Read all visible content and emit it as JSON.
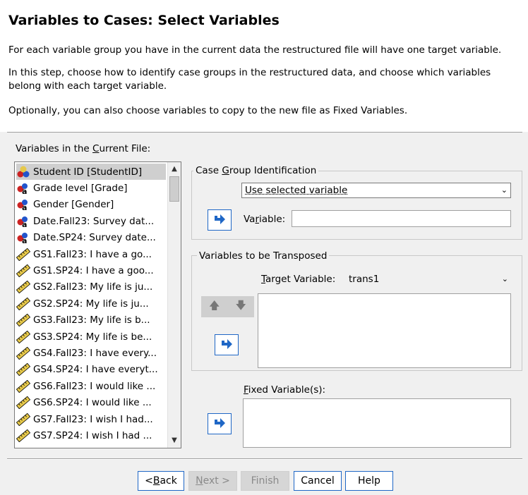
{
  "header": {
    "title": "Variables to Cases: Select Variables",
    "p1": "For each variable group you have in the current data the restructured file will have one target variable.",
    "p2": "In this step, choose how to identify case groups in the restructured data, and choose which variables belong with each target variable.",
    "p3": "Optionally, you can also choose variables to copy to the new file as Fixed Variables."
  },
  "source": {
    "label_pre": "Variables in the ",
    "label_u": "C",
    "label_post": "urrent File:",
    "items": [
      {
        "label": "Student ID [StudentID]",
        "icon": "nominal-icon",
        "selected": true
      },
      {
        "label": "Grade level [Grade]",
        "icon": "ordinal-string-icon"
      },
      {
        "label": "Gender [Gender]",
        "icon": "ordinal-string-icon"
      },
      {
        "label": "Date.Fall23: Survey dat...",
        "icon": "ordinal-string-icon"
      },
      {
        "label": "Date.SP24: Survey date...",
        "icon": "ordinal-string-icon"
      },
      {
        "label": "GS1.Fall23: I have a go...",
        "icon": "scale-ruler-icon"
      },
      {
        "label": "GS1.SP24: I have a goo...",
        "icon": "scale-ruler-icon"
      },
      {
        "label": "GS2.Fall23: My life is ju...",
        "icon": "scale-ruler-icon"
      },
      {
        "label": "GS2.SP24: My life is ju...",
        "icon": "scale-ruler-icon"
      },
      {
        "label": "GS3.Fall23: My life is b...",
        "icon": "scale-ruler-icon"
      },
      {
        "label": "GS3.SP24: My life is be...",
        "icon": "scale-ruler-icon"
      },
      {
        "label": "GS4.Fall23: I have every...",
        "icon": "scale-ruler-icon"
      },
      {
        "label": "GS4.SP24: I have everyt...",
        "icon": "scale-ruler-icon"
      },
      {
        "label": "GS6.Fall23: I would like ...",
        "icon": "scale-ruler-icon"
      },
      {
        "label": "GS6.SP24: I would like ...",
        "icon": "scale-ruler-icon"
      },
      {
        "label": "GS7.Fall23: I wish I had...",
        "icon": "scale-ruler-icon"
      },
      {
        "label": "GS7.SP24: I wish I had ...",
        "icon": "scale-ruler-icon"
      }
    ]
  },
  "case_group": {
    "title_pre": "Case ",
    "title_u": "G",
    "title_post": "roup Identification",
    "method": "Use selected variable",
    "variable_label_pre": "Va",
    "variable_label_u": "r",
    "variable_label_post": "iable:",
    "variable_value": ""
  },
  "transposed": {
    "title": "Variables to be Transposed",
    "target_label_u": "T",
    "target_label_post": "arget Variable:",
    "target_value": "trans1"
  },
  "fixed": {
    "label_u": "F",
    "label_post": "ixed Variable(s):"
  },
  "buttons": {
    "back_pre": "< ",
    "back_u": "B",
    "back_post": "ack",
    "next_u": "N",
    "next_post": "ext >",
    "finish": "Finish",
    "cancel": "Cancel",
    "help": "Help"
  },
  "colors": {
    "accent": "#1f67c6",
    "nominal_red": "#cc2222",
    "nominal_blue": "#2255cc",
    "scale_yellow": "#e6c84a"
  }
}
